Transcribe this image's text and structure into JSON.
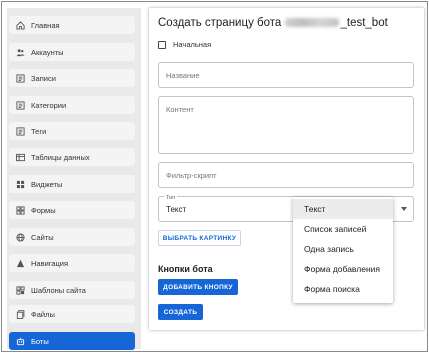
{
  "sidebar": {
    "items": [
      {
        "label": "Главная",
        "icon": "home-icon"
      },
      {
        "label": "Аккаунты",
        "icon": "accounts-icon"
      },
      {
        "label": "Записи",
        "icon": "records-icon"
      },
      {
        "label": "Категории",
        "icon": "categories-icon"
      },
      {
        "label": "Теги",
        "icon": "tags-icon"
      },
      {
        "label": "Таблицы данных",
        "icon": "table-icon"
      },
      {
        "label": "Виджеты",
        "icon": "widgets-icon"
      },
      {
        "label": "Формы",
        "icon": "forms-icon"
      },
      {
        "label": "Сайты",
        "icon": "globe-icon"
      },
      {
        "label": "Навигация",
        "icon": "navigation-icon"
      },
      {
        "label": "Шаблоны сайта",
        "icon": "templates-icon"
      },
      {
        "label": "Файлы",
        "icon": "files-icon"
      },
      {
        "label": "Боты",
        "icon": "bot-icon",
        "active": true
      }
    ],
    "active_color": "#1666d8"
  },
  "page": {
    "title_prefix": "Создать страницу бота",
    "title_suffix": "_test_bot"
  },
  "form": {
    "checkbox_label": "Начальная",
    "name_placeholder": "Название",
    "content_placeholder": "Контент",
    "filter_placeholder": "Фильтр-скрипт",
    "type_label": "Тип",
    "type_value": "Текст",
    "select_image_button": "ВЫБРАТЬ КАРТИНКУ",
    "bot_buttons_title": "Кнопки бота",
    "add_button": "ДОБАВИТЬ КНОПКУ",
    "create_button": "СОЗДАТЬ"
  },
  "dropdown": {
    "options": [
      "Текст",
      "Список записей",
      "Одна запись",
      "Форма добавления",
      "Форма поиска"
    ],
    "selected_index": 0
  }
}
